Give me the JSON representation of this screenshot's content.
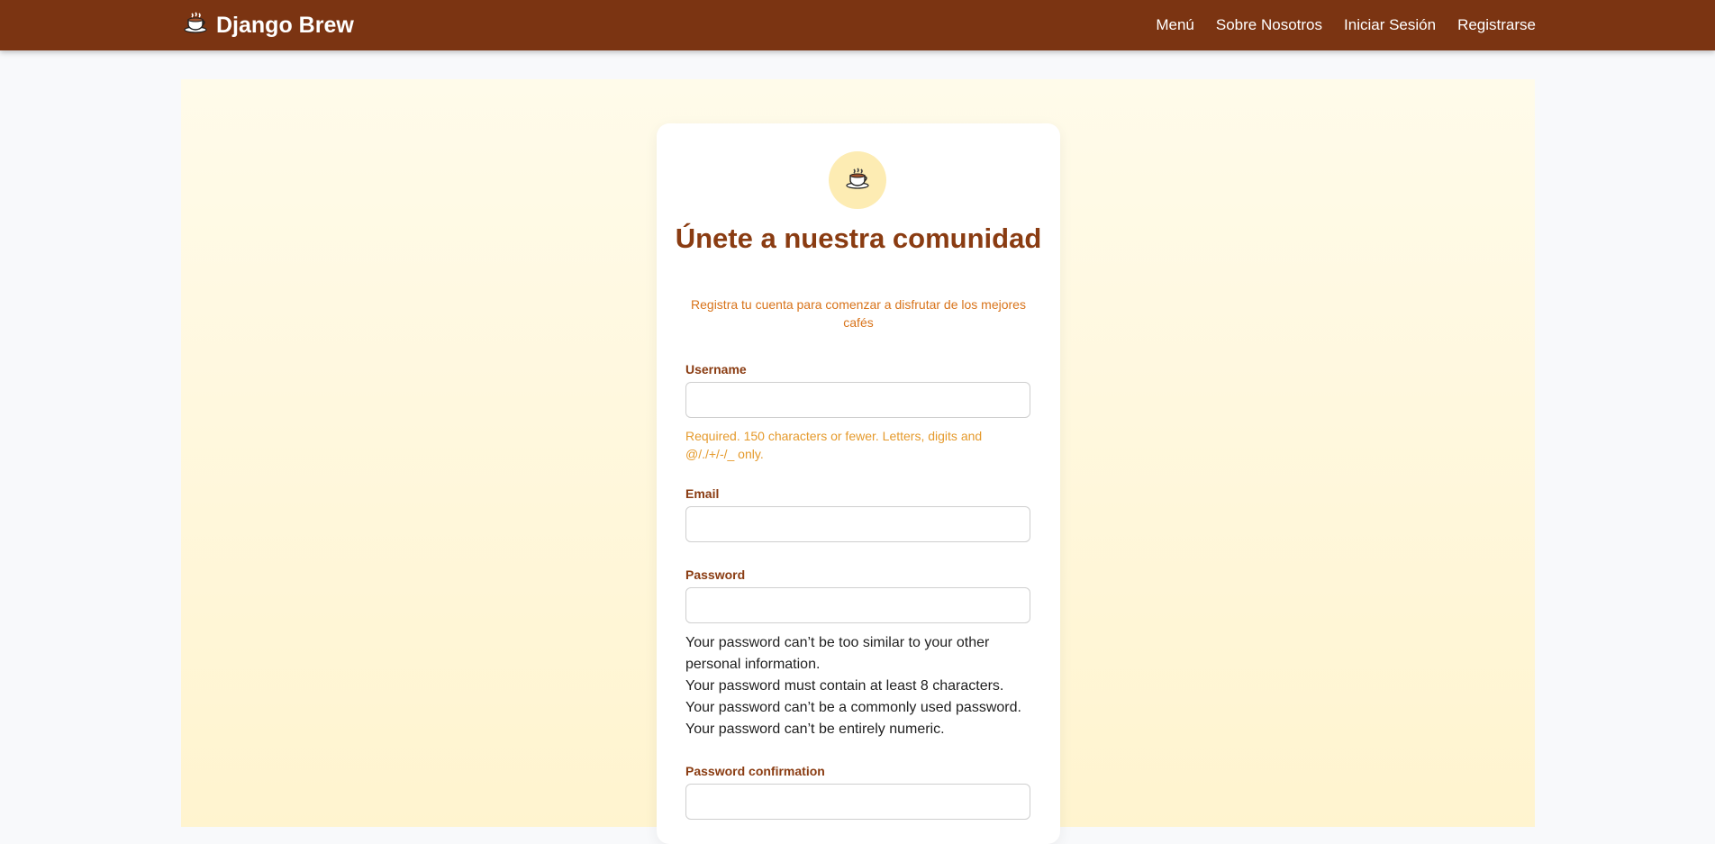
{
  "navbar": {
    "brand_icon": "coffee-cup-icon",
    "brand": "Django Brew",
    "links": [
      "Menú",
      "Sobre Nosotros",
      "Iniciar Sesión",
      "Registrarse"
    ]
  },
  "card": {
    "logo_icon": "coffee-cup-icon",
    "title": "Únete a nuestra comunidad",
    "subtitle": "Registra tu cuenta para comenzar a disfrutar de los mejores cafés"
  },
  "form": {
    "username_label": "Username",
    "username_value": "",
    "username_help": "Required. 150 characters or fewer. Letters, digits and @/./+/-/_ only.",
    "email_label": "Email",
    "email_value": "",
    "password_label": "Password",
    "password_value": "",
    "password_help": [
      "Your password can’t be too similar to your other personal information.",
      "Your password must contain at least 8 characters.",
      "Your password can’t be a commonly used password.",
      "Your password can’t be entirely numeric."
    ],
    "password_confirm_label": "Password confirmation",
    "password_confirm_value": ""
  },
  "colors": {
    "navbar_bg": "#7b3412",
    "title": "#8a3c12",
    "accent_orange": "#d8731a",
    "help_orange": "#e59a2c",
    "hero_bg": "#fff4cf"
  }
}
